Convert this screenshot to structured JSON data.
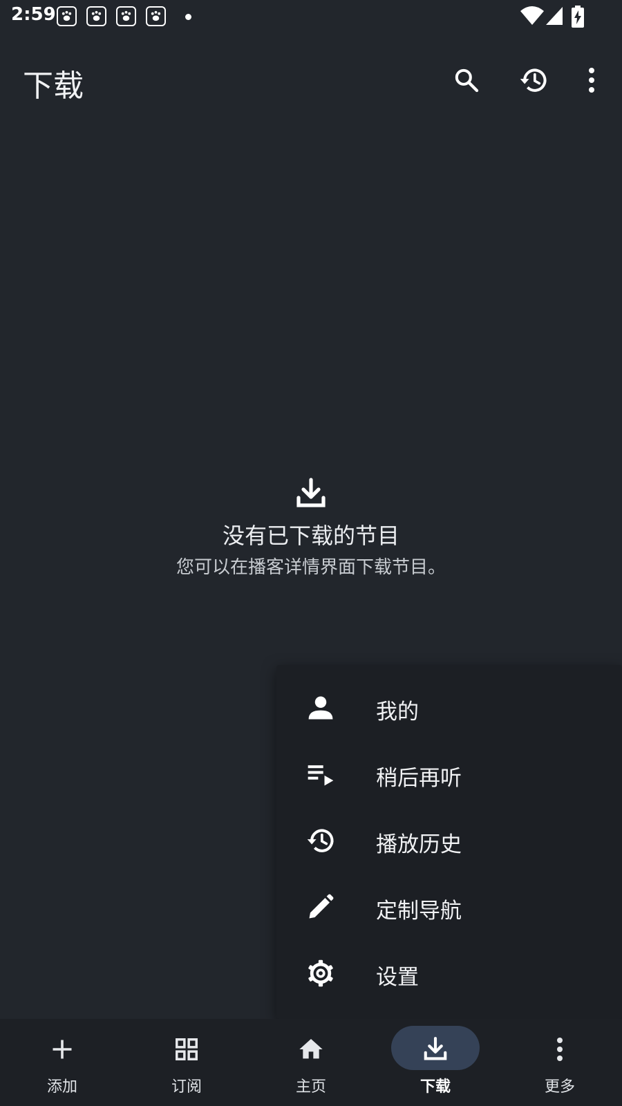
{
  "status_bar": {
    "time": "2:59",
    "notification_icons": [
      "baidu-paw-icon",
      "baidu-paw-icon",
      "baidu-paw-icon",
      "baidu-paw-icon"
    ],
    "icons": [
      "wifi-icon",
      "cell-signal-icon",
      "battery-charging-icon"
    ]
  },
  "app_bar": {
    "title": "下载",
    "actions": [
      "search-icon",
      "history-icon",
      "more-vert-icon"
    ]
  },
  "empty_state": {
    "icon": "download-icon",
    "title": "没有已下载的节目",
    "subtitle": "您可以在播客详情界面下载节目。"
  },
  "menu": {
    "items": [
      {
        "label": "我的",
        "icon": "person-icon"
      },
      {
        "label": "稍后再听",
        "icon": "playlist-play-icon"
      },
      {
        "label": "播放历史",
        "icon": "history-icon"
      },
      {
        "label": "定制导航",
        "icon": "edit-pencil-icon"
      },
      {
        "label": "设置",
        "icon": "settings-gear-icon"
      }
    ]
  },
  "bottom_nav": {
    "items": [
      {
        "label": "添加",
        "icon": "add-icon"
      },
      {
        "label": "订阅",
        "icon": "grid-icon"
      },
      {
        "label": "主页",
        "icon": "home-icon"
      },
      {
        "label": "下载",
        "icon": "download-icon",
        "active": true
      },
      {
        "label": "更多",
        "icon": "more-vert-icon"
      }
    ]
  },
  "colors": {
    "background": "#22262c",
    "menu_background": "#1c1f24",
    "nav_background": "#1d2025",
    "active_pill": "#354257"
  }
}
